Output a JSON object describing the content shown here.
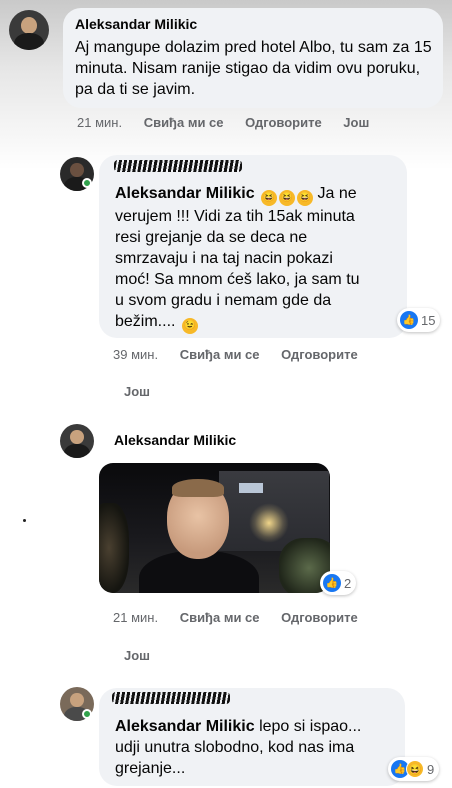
{
  "comments": [
    {
      "author": "Aleksandar Milikic",
      "text": "Aj mangupe dolazim pred hotel Albo, tu sam za 15 minuta. Nisam ranije stigao da vidim ovu poruku, pa da ti se javim.",
      "time": "21 мин.",
      "like": "Свиђа ми се",
      "reply": "Одговорите",
      "more": "Још"
    },
    {
      "mention": "Aleksandar Milikic",
      "text_lines": [
        "Ja ne",
        "verujem !!! Vidi za tih 15ak minuta",
        "resi grejanje da se deca ne",
        "smrzavaju i na taj nacin pokazi",
        "moć! Sa mnom ćeš lako, ja sam tu",
        "u svom gradu i nemam gde da",
        "bežim...."
      ],
      "reaction_count": "15",
      "time": "39 мин.",
      "like": "Свиђа ми се",
      "reply": "Одговорите",
      "more": "Још"
    },
    {
      "author": "Aleksandar Milikic",
      "reaction_count": "2",
      "time": "21 мин.",
      "like": "Свиђа ми се",
      "reply": "Одговорите",
      "more": "Још"
    },
    {
      "mention": "Aleksandar Milikic",
      "text_lines": [
        "lepo si ispao...",
        "udji unutra slobodno, kod nas ima",
        "grejanje..."
      ],
      "reaction_count": "9"
    }
  ],
  "icons": {
    "like": "like-icon",
    "haha": "haha-icon",
    "rofl": "rolling-laughing-emoji",
    "wink": "smile-emoji"
  },
  "colors": {
    "bubble": "#f0f2f5",
    "like_blue": "#1877f2",
    "meta_gray": "#65676b",
    "online": "#31a24c"
  }
}
